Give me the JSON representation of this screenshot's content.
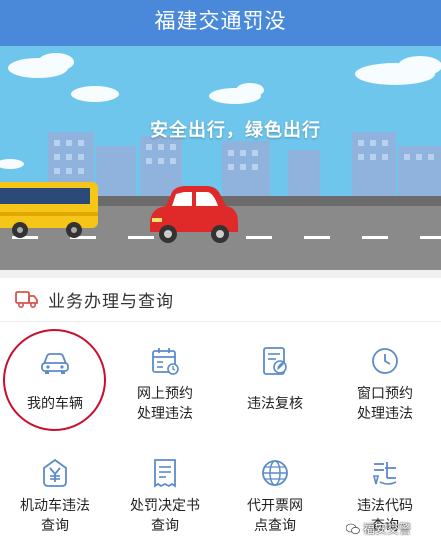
{
  "header": {
    "title": "福建交通罚没"
  },
  "banner": {
    "slogan": "安全出行，绿色出行"
  },
  "section": {
    "title": "业务办理与查询",
    "icon": "truck-icon"
  },
  "services": [
    {
      "line1": "我的车辆",
      "line2": "",
      "icon": "car-icon"
    },
    {
      "line1": "网上预约",
      "line2": "处理违法",
      "icon": "calendar-icon"
    },
    {
      "line1": "违法复核",
      "line2": "",
      "icon": "document-edit-icon"
    },
    {
      "line1": "窗口预约",
      "line2": "处理违法",
      "icon": "clock-icon"
    },
    {
      "line1": "机动车违法",
      "line2": "查询",
      "icon": "yen-icon"
    },
    {
      "line1": "处罚决定书",
      "line2": "查询",
      "icon": "receipt-icon"
    },
    {
      "line1": "代开票网",
      "line2": "点查询",
      "icon": "globe-icon"
    },
    {
      "line1": "违法代码",
      "line2": "查询",
      "icon": "code-icon"
    }
  ],
  "watermark": {
    "text": "福安交警"
  },
  "colors": {
    "primary": "#4a89d9",
    "icon": "#5b8bc9",
    "highlight": "#c8102e"
  }
}
